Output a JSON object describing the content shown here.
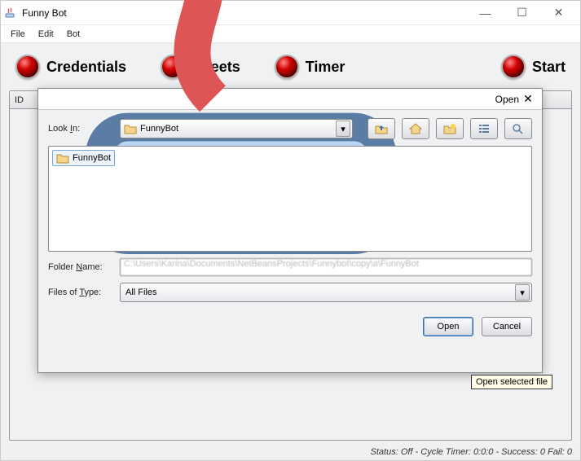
{
  "window": {
    "title": "Funny Bot",
    "menu": {
      "file": "File",
      "edit": "Edit",
      "bot": "Bot"
    },
    "tabs": {
      "credentials": "Credentials",
      "tweets": "Tweets",
      "timer": "Timer",
      "start": "Start"
    },
    "id_header": "ID"
  },
  "dialog": {
    "title": "Open",
    "look_in_label": "Look In:",
    "look_in_value": "FunnyBot",
    "file_item": "FunnyBot",
    "folder_name_label": "Folder Name:",
    "folder_name_value": "C:\\Users\\Karina\\Documents\\NetBeansProjects\\Funnybot\\copy\\a\\FunnyBot",
    "files_type_label": "Files of Type:",
    "files_type_value": "All Files",
    "open_btn": "Open",
    "cancel_btn": "Cancel"
  },
  "tooltip": "Open selected file",
  "status": "Status: Off - Cycle Timer: 0:0:0 - Success: 0 Fail: 0",
  "icons": {
    "up": "up-folder-icon",
    "home": "home-icon",
    "newfolder": "new-folder-icon",
    "list": "list-view-icon",
    "details": "details-view-icon"
  }
}
